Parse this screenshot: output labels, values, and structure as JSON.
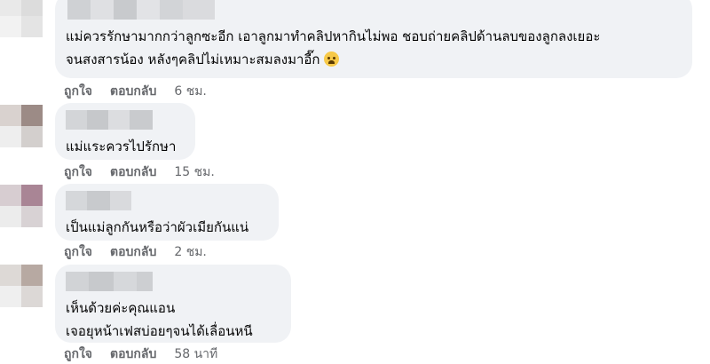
{
  "labels": {
    "like": "ถูกใจ",
    "reply": "ตอบกลับ"
  },
  "comments": [
    {
      "lines": [
        "แม่ควรรักษามากกว่าลูกซะอีก เอาลูกมาทำคลิปหากินไม่พอ ชอบถ่ายคลิปด้านลบของลูกลงเยอะ",
        "จนสงสารน้อง หลังๆคลิปไม่เหมาะสมลงมาอี๊ก"
      ],
      "emoji": "crying-face-emoji",
      "time": "6 ชม."
    },
    {
      "lines": [
        "แม่แระควรไปรักษา"
      ],
      "time": "15 ชม."
    },
    {
      "lines": [
        "เป็นแม่ลูกกันหรือว่าผัวเมียกันแน่"
      ],
      "time": "2 ชม."
    },
    {
      "lines": [
        "เห็นด้วยค่ะคุณแอน",
        "เจอยุหน้าเฟสบ่อยๆจนได้เลื่อนหนี"
      ],
      "time": "58 นาที"
    }
  ],
  "colors": {
    "bubble": "#f0f2f5",
    "muted": "#65676b",
    "text": "#050505"
  }
}
